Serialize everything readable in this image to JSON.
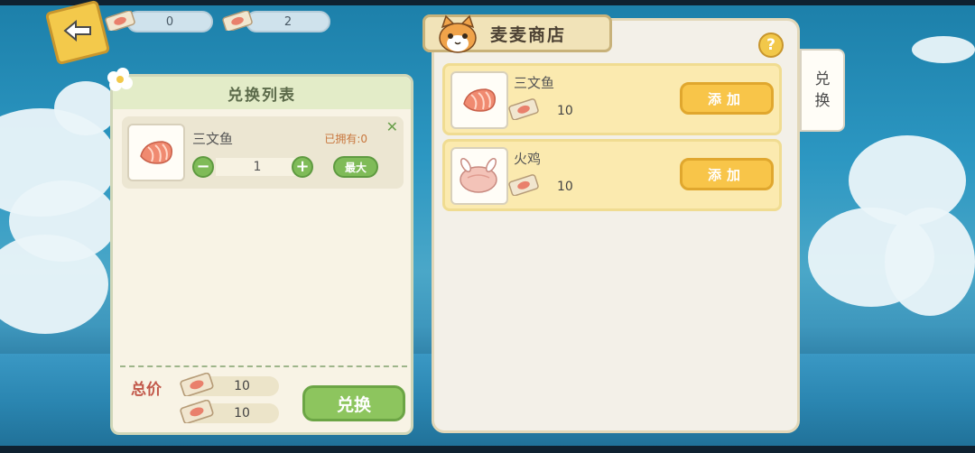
{
  "currency": [
    {
      "icon": "salmon-ticket-icon",
      "value": "0"
    },
    {
      "icon": "salmon-ticket-icon",
      "value": "2"
    }
  ],
  "exchange_list": {
    "title": "兑换列表",
    "item": {
      "icon": "salmon-icon",
      "name": "三文鱼",
      "owned": "已拥有:0",
      "quantity": "1",
      "max_label": "最大",
      "decrement_label": "−",
      "increment_label": "+"
    },
    "total_label": "总价",
    "costs": [
      "10",
      "10"
    ],
    "exchange_button": "兑换"
  },
  "shop": {
    "title": "麦麦商店",
    "help_label": "?",
    "side_tab": [
      "兑",
      "换"
    ],
    "items": [
      {
        "icon": "salmon-icon",
        "name": "三文鱼",
        "price": "10",
        "button": "添加"
      },
      {
        "icon": "turkey-icon",
        "name": "火鸡",
        "price": "10",
        "button": "添加"
      }
    ]
  },
  "colors": {
    "green_button": "#8dc55e",
    "yellow_button": "#f8c549",
    "total_label": "#c2584a"
  }
}
